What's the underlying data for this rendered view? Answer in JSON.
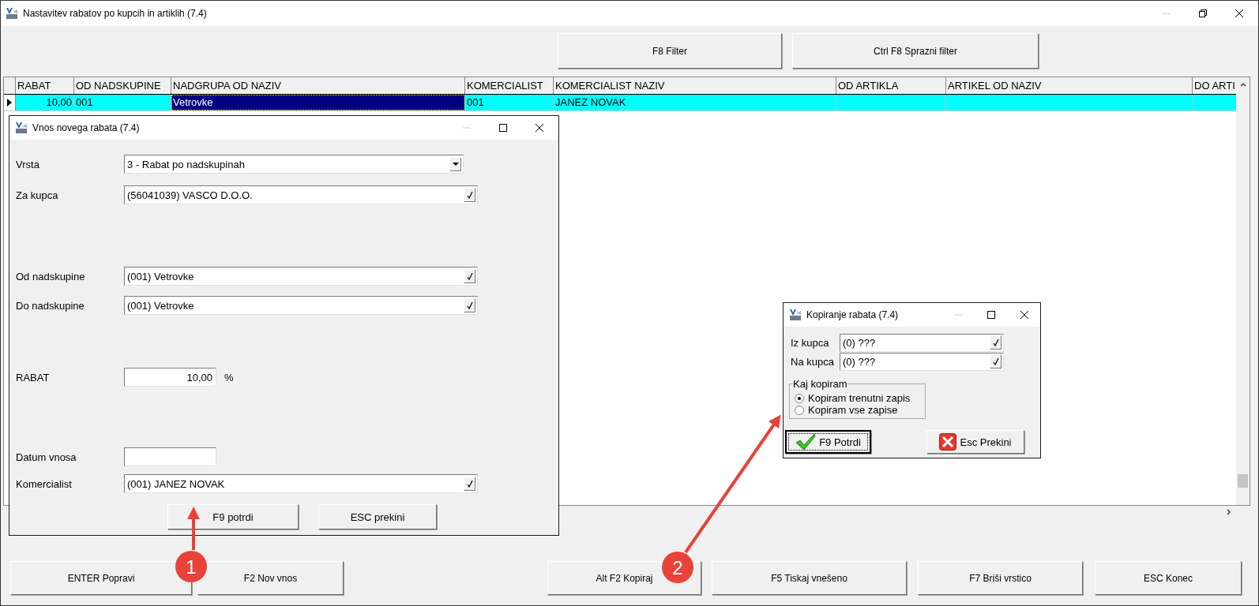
{
  "window": {
    "title": "Nastavitev rabatov po kupcih in artiklih  (7.4)"
  },
  "toolbar": [
    "F8 Filter",
    "Ctrl F8 Sprazni filter"
  ],
  "grid": {
    "columns": [
      {
        "label": "RABAT",
        "kind": "number"
      },
      {
        "label": "OD NADSKUPINE",
        "kind": "text"
      },
      {
        "label": "NADGRUPA OD NAZIV",
        "kind": "text"
      },
      {
        "label": "KOMERCIALIST",
        "kind": "text"
      },
      {
        "label": "KOMERCIALIST NAZIV",
        "kind": "text"
      },
      {
        "label": "OD ARTIKLA",
        "kind": "text"
      },
      {
        "label": "ARTIKEL OD NAZIV",
        "kind": "text"
      },
      {
        "label": "DO ARTI",
        "kind": "text"
      }
    ],
    "rows": [
      {
        "selected": true,
        "cells": [
          {
            "text": "10,00",
            "focused": false
          },
          {
            "text": "001",
            "focused": false
          },
          {
            "text": "Vetrovke",
            "focused": true
          },
          {
            "text": "001",
            "focused": false
          },
          {
            "text": "JANEZ NOVAK",
            "focused": false
          }
        ]
      }
    ]
  },
  "bottom_buttons": [
    "ENTER Popravi",
    "F2 Nov vnos",
    "Alt F2 Kopiraj",
    "F5 Tiskaj vnešeno",
    "F7 Briši vrstico",
    "ESC Konec"
  ],
  "entry_dialog": {
    "title": "Vnos novega rabata  (7.4)",
    "fields": [
      {
        "label": "Vrsta",
        "kind": "dropdown",
        "value": "3 - Rabat po nadskupinah"
      },
      {
        "label": "Za kupca",
        "kind": "lookup",
        "value": "(56041039) VASCO D.O.O."
      },
      {
        "label": "Od nadskupine",
        "kind": "lookup",
        "value": "(001) Vetrovke"
      },
      {
        "label": "Do nadskupine",
        "kind": "lookup",
        "value": "(001) Vetrovke"
      },
      {
        "label": "RABAT",
        "kind": "number",
        "value": "10,00",
        "suffix": "%"
      },
      {
        "label": "Datum vnosa",
        "kind": "date"
      },
      {
        "label": "Komercialist",
        "kind": "lookup",
        "value": "(001) JANEZ NOVAK"
      }
    ],
    "buttons": [
      "F9  potrdi",
      "ESC  prekini"
    ]
  },
  "copy_dialog": {
    "title": "Kopiranje rabata  (7.4)",
    "fields": [
      {
        "label": "Iz kupca",
        "value": "(0) ???"
      },
      {
        "label": "Na kupca",
        "value": "(0) ???"
      }
    ],
    "group": {
      "title": "Kaj kopiram",
      "options": [
        {
          "label": "Kopiram trenutni zapis",
          "selected": true
        },
        {
          "label": "Kopiram vse zapise",
          "selected": false
        }
      ]
    },
    "buttons": [
      {
        "label": "F9 Potrdi",
        "kind": "confirm",
        "focused": true
      },
      {
        "label": "Esc Prekini",
        "kind": "cancel",
        "focused": false
      }
    ]
  },
  "annotations": [
    {
      "number": "1"
    },
    {
      "number": "2"
    }
  ]
}
